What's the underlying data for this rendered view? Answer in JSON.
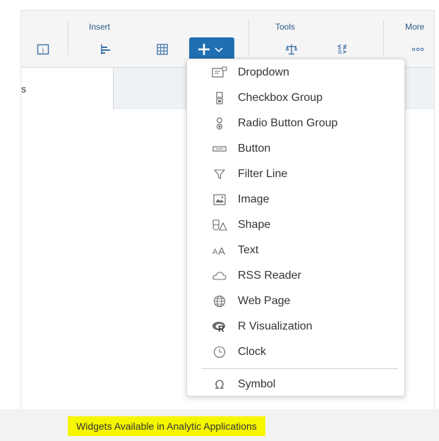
{
  "toolbar": {
    "groups": {
      "insert": "Insert",
      "tools": "Tools",
      "more": "More"
    }
  },
  "tab": {
    "label": "s"
  },
  "menu": {
    "items": [
      {
        "label": "Dropdown",
        "icon": "dropdown-icon"
      },
      {
        "label": "Checkbox Group",
        "icon": "checkbox-group-icon"
      },
      {
        "label": "Radio Button Group",
        "icon": "radio-button-group-icon"
      },
      {
        "label": "Button",
        "icon": "button-icon"
      },
      {
        "label": "Filter Line",
        "icon": "filter-icon"
      },
      {
        "label": "Image",
        "icon": "image-icon"
      },
      {
        "label": "Shape",
        "icon": "shape-icon"
      },
      {
        "label": "Text",
        "icon": "text-icon"
      },
      {
        "label": "RSS Reader",
        "icon": "cloud-icon"
      },
      {
        "label": "Web Page",
        "icon": "globe-icon"
      },
      {
        "label": "R Visualization",
        "icon": "r-logo-icon"
      },
      {
        "label": "Clock",
        "icon": "clock-icon"
      },
      {
        "label": "Symbol",
        "icon": "omega-icon"
      }
    ]
  },
  "caption": {
    "text": "Widgets Available in Analytic Applications"
  },
  "colors": {
    "accent": "#1f6fb2",
    "highlight": "#f6f600"
  }
}
